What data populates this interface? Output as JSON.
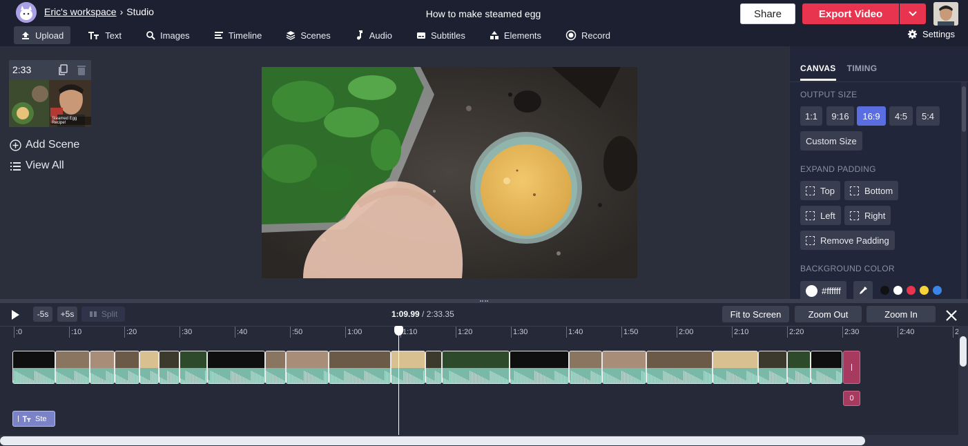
{
  "header": {
    "workspace_label": "Eric's workspace",
    "separator": "›",
    "section_label": "Studio",
    "project_title": "How to make steamed egg",
    "share_label": "Share",
    "export_label": "Export Video"
  },
  "menu": {
    "items": [
      {
        "label": "Upload",
        "icon": "upload-icon"
      },
      {
        "label": "Text",
        "icon": "text-icon"
      },
      {
        "label": "Images",
        "icon": "search-icon"
      },
      {
        "label": "Timeline",
        "icon": "timeline-icon"
      },
      {
        "label": "Scenes",
        "icon": "layers-icon"
      },
      {
        "label": "Audio",
        "icon": "music-note-icon"
      },
      {
        "label": "Subtitles",
        "icon": "subtitles-icon"
      },
      {
        "label": "Elements",
        "icon": "shapes-icon"
      },
      {
        "label": "Record",
        "icon": "record-icon"
      }
    ],
    "settings_label": "Settings"
  },
  "scenes": {
    "duration": "2:33",
    "thumb_caption": "Steamed Egg Recipe!",
    "add_scene_label": "Add Scene",
    "view_all_label": "View All"
  },
  "properties": {
    "tab_canvas": "CANVAS",
    "tab_timing": "TIMING",
    "output_size_title": "OUTPUT SIZE",
    "sizes": [
      "1:1",
      "9:16",
      "16:9",
      "4:5",
      "5:4"
    ],
    "selected_size": "16:9",
    "custom_size_label": "Custom Size",
    "expand_padding_title": "EXPAND PADDING",
    "pad_top": "Top",
    "pad_bottom": "Bottom",
    "pad_left": "Left",
    "pad_right": "Right",
    "remove_padding": "Remove Padding",
    "background_color_title": "BACKGROUND COLOR",
    "background_color_value": "#ffffff",
    "swatches": [
      "#111111",
      "#ffffff",
      "#e8344e",
      "#f5d33a",
      "#3a86e8"
    ]
  },
  "timeline": {
    "back_label": "-5s",
    "fwd_label": "+5s",
    "split_label": "Split",
    "current_time": "1:09.99",
    "separator": " / ",
    "total_time": "2:33.35",
    "fit_label": "Fit to Screen",
    "zoom_out_label": "Zoom Out",
    "zoom_in_label": "Zoom In",
    "ruler_labels": [
      ":0",
      ":10",
      ":20",
      ":30",
      ":40",
      ":50",
      "1:00",
      "1:10",
      "1:20",
      "1:30",
      "1:40",
      "1:50",
      "2:00",
      "2:10",
      "2:20",
      "2:30",
      "2:40",
      "2"
    ],
    "end_badge": "0",
    "text_track_label": "Ste"
  },
  "colors": {
    "accent": "#5b6ee1",
    "export": "#e8344e",
    "waveform": "#7ab8a7",
    "text_track": "#7a82c8",
    "end_marker": "#a73a5f"
  }
}
